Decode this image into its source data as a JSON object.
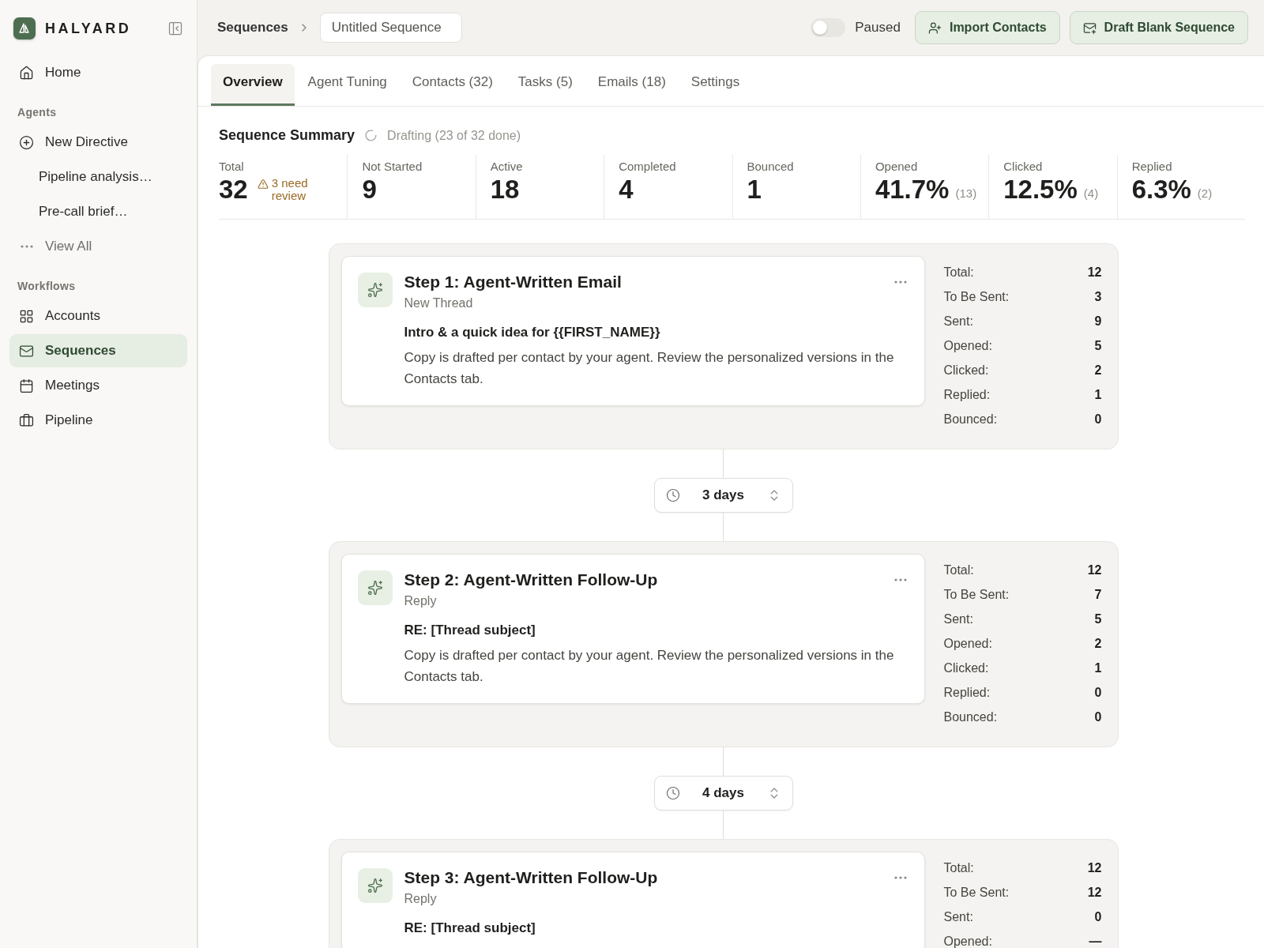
{
  "sidebar": {
    "brand": "HALYARD",
    "items": [
      {
        "kind": "link",
        "label": "Home",
        "selected": false
      },
      {
        "kind": "heading",
        "label": "Agents"
      },
      {
        "kind": "link",
        "label": "New Directive",
        "selected": false
      },
      {
        "kind": "sub",
        "label": "Pipeline analysis…"
      },
      {
        "kind": "sub",
        "label": "Pre-call brief…"
      },
      {
        "kind": "more",
        "label": "View All"
      },
      {
        "kind": "heading",
        "label": "Workflows"
      },
      {
        "kind": "link",
        "label": "Accounts",
        "selected": false
      },
      {
        "kind": "link",
        "label": "Sequences",
        "selected": true
      },
      {
        "kind": "link",
        "label": "Meetings",
        "selected": false
      },
      {
        "kind": "link",
        "label": "Pipeline",
        "selected": false
      }
    ]
  },
  "header": {
    "breadcrumb": "Sequences",
    "sequence_name": "Untitled Sequence",
    "toggle": {
      "on": false,
      "label": "Paused"
    },
    "buttons": [
      "Import Contacts",
      "Draft Blank Sequence"
    ]
  },
  "tabs": [
    {
      "label": "Overview",
      "selected": true
    },
    {
      "label": "Agent Tuning",
      "selected": false
    },
    {
      "label": "Contacts (32)",
      "selected": false
    },
    {
      "label": "Tasks (5)",
      "selected": false
    },
    {
      "label": "Emails (18)",
      "selected": false
    },
    {
      "label": "Settings",
      "selected": false
    }
  ],
  "summary": {
    "title": "Sequence Summary",
    "status": "Drafting (23 of 32 done)",
    "stats": [
      {
        "label": "Total",
        "value": "32",
        "warning": "3 need review"
      },
      {
        "label": "Not Started",
        "value": "9"
      },
      {
        "label": "Active",
        "value": "18"
      },
      {
        "label": "Completed",
        "value": "4"
      },
      {
        "label": "Bounced",
        "value": "1"
      },
      {
        "label": "Opened",
        "value": "41.7%",
        "count": "(13)"
      },
      {
        "label": "Clicked",
        "value": "12.5%",
        "count": "(4)"
      },
      {
        "label": "Replied",
        "value": "6.3%",
        "count": "(2)"
      }
    ]
  },
  "steps": [
    {
      "title": "Step 1: Agent-Written Email",
      "subtitle": "New Thread",
      "subject": "Intro & a quick idea for {{FIRST_NAME}}",
      "body": "Copy is drafted per contact by your agent. Review the personalized versions in the Contacts tab.",
      "delay": "3 days",
      "stats": [
        {
          "label": "Total:",
          "value": "12"
        },
        {
          "label": "To Be Sent:",
          "value": "3"
        },
        {
          "label": "Sent:",
          "value": "9"
        },
        {
          "label": "Opened:",
          "value": "5"
        },
        {
          "label": "Clicked:",
          "value": "2"
        },
        {
          "label": "Replied:",
          "value": "1"
        },
        {
          "label": "Bounced:",
          "value": "0"
        }
      ]
    },
    {
      "title": "Step 2: Agent-Written Follow-Up",
      "subtitle": "Reply",
      "subject": "RE: [Thread subject]",
      "body": "Copy is drafted per contact by your agent. Review the personalized versions in the Contacts tab.",
      "delay": "4 days",
      "stats": [
        {
          "label": "Total:",
          "value": "12"
        },
        {
          "label": "To Be Sent:",
          "value": "7"
        },
        {
          "label": "Sent:",
          "value": "5"
        },
        {
          "label": "Opened:",
          "value": "2"
        },
        {
          "label": "Clicked:",
          "value": "1"
        },
        {
          "label": "Replied:",
          "value": "0"
        },
        {
          "label": "Bounced:",
          "value": "0"
        }
      ]
    },
    {
      "title": "Step 3: Agent-Written Follow-Up",
      "subtitle": "Reply",
      "subject": "RE: [Thread subject]",
      "stats": [
        {
          "label": "Total:",
          "value": "12"
        },
        {
          "label": "To Be Sent:",
          "value": "12"
        },
        {
          "label": "Sent:",
          "value": "0"
        },
        {
          "label": "Opened:",
          "value": "—"
        }
      ]
    }
  ]
}
